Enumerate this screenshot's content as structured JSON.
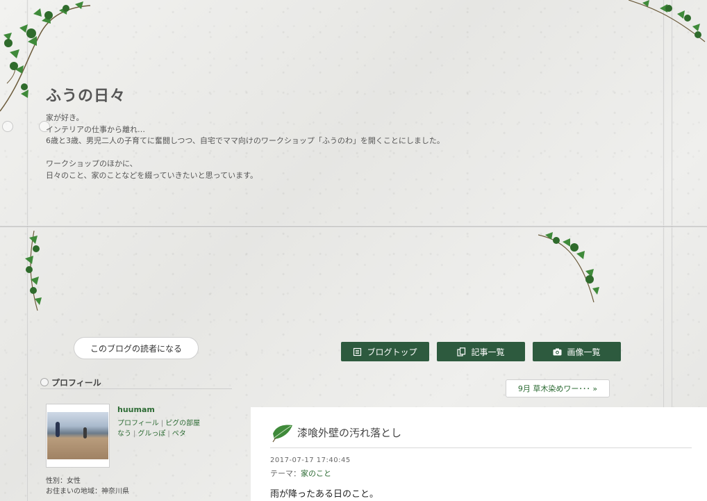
{
  "header": {
    "title": "ふうの日々",
    "description": "家が好き。\nインテリアの仕事から離れ…\n6歳と3歳、男児二人の子育てに奮闘しつつ、自宅でママ向けのワークショップ「ふうのわ」を開くことにしました。\n\nワークショップのほかに、\n日々のこと、家のことなどを綴っていきたいと思っています。"
  },
  "actions": {
    "reader_button": "このブログの読者になる"
  },
  "nav": {
    "blog_top": "ブログトップ",
    "article_list": "記事一覧",
    "image_list": "画像一覧"
  },
  "sidebar": {
    "profile_title": "プロフィール",
    "username": "huumam",
    "links_row1": [
      "プロフィール",
      "ピグの部屋"
    ],
    "links_row2": [
      "なう",
      "グルっぽ",
      "ペタ"
    ],
    "info": [
      "性別：女性",
      "お住まいの地域：神奈川県"
    ]
  },
  "pager": {
    "prev_label": "9月 草木染めワー･･･ »"
  },
  "article": {
    "title": "漆喰外壁の汚れ落とし",
    "date": "2017-07-17 17:40:45",
    "theme_label": "テーマ：",
    "theme": "家のこと",
    "body_first_line": "雨が降ったある日のこと。"
  },
  "colors": {
    "accent_green": "#2d5a3e",
    "link_green": "#2d6b34"
  }
}
